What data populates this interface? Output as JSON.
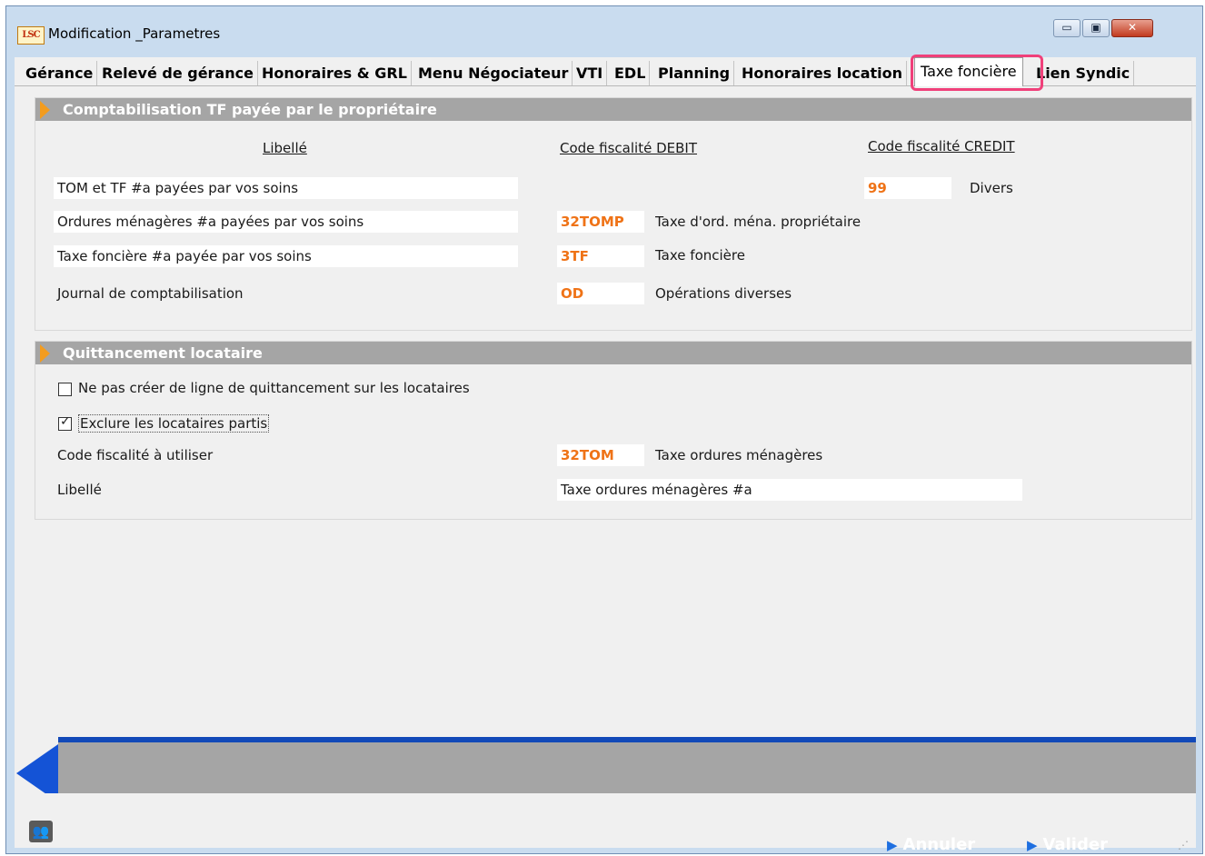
{
  "window": {
    "title": "Modification _Parametres",
    "logo_text": "LSC"
  },
  "titlebar_buttons": {
    "minimize": "▭",
    "maximize": "▣",
    "close": "✕"
  },
  "tabs": [
    {
      "label": "Gérance"
    },
    {
      "label": "Relevé de gérance"
    },
    {
      "label": "Honoraires & GRL"
    },
    {
      "label": "Menu Négociateur"
    },
    {
      "label": "VTI"
    },
    {
      "label": "EDL"
    },
    {
      "label": "Planning"
    },
    {
      "label": "Honoraires location"
    },
    {
      "label": "Taxe foncière",
      "active": true
    },
    {
      "label": "Lien Syndic"
    }
  ],
  "section1": {
    "title": "Comptabilisation TF payée par le propriétaire",
    "col_libelle": "Libellé",
    "col_debit": "Code fiscalité DEBIT",
    "col_credit": "Code fiscalité CREDIT",
    "row1": {
      "libelle": "TOM et TF #a payées par vos soins",
      "credit_code": "99",
      "credit_label": "Divers"
    },
    "row2": {
      "libelle": "Ordures ménagères #a payées par vos soins",
      "debit_code": "32TOMP",
      "debit_label": "Taxe d'ord. ména. propriétaire"
    },
    "row3": {
      "libelle": "Taxe foncière #a payée par vos soins",
      "debit_code": "3TF",
      "debit_label": "Taxe foncière"
    },
    "row4": {
      "label": "Journal de comptabilisation",
      "code": "OD",
      "code_label": "Opérations diverses"
    }
  },
  "section2": {
    "title": "Quittancement locataire",
    "checkbox1": {
      "label": "Ne pas créer de ligne de quittancement sur les locataires",
      "checked": false
    },
    "checkbox2": {
      "label": "Exclure les locataires partis",
      "checked": true
    },
    "code_label": "Code fiscalité à utiliser",
    "code": "32TOM",
    "code_desc": "Taxe ordures ménagères",
    "libelle_label": "Libellé",
    "libelle_value": "Taxe ordures ménagères #a"
  },
  "footer": {
    "cancel_label": "Annuler",
    "validate_label": "Valider"
  }
}
